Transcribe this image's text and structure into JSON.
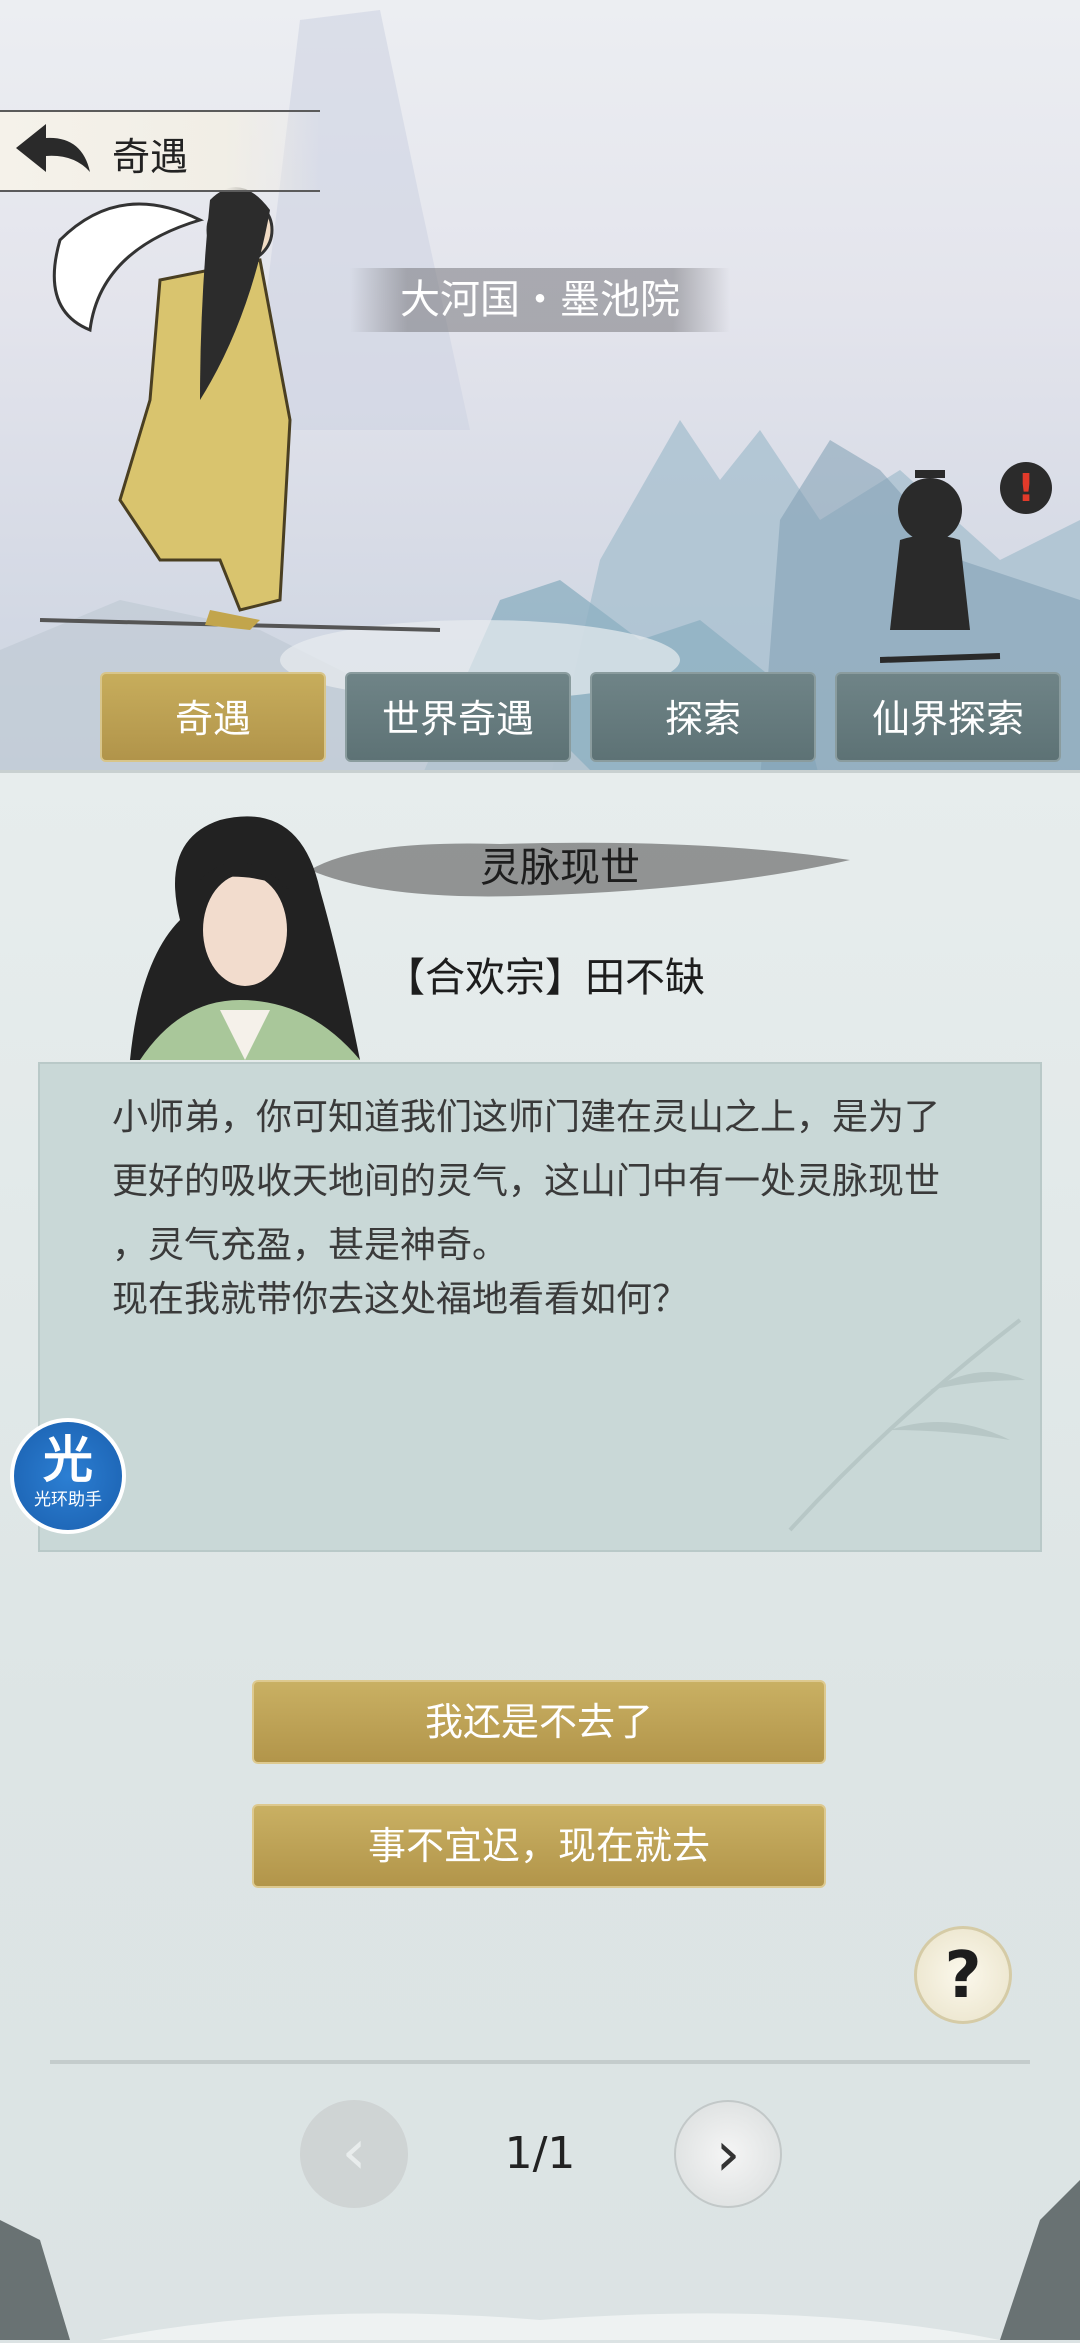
{
  "header": {
    "title": "奇遇"
  },
  "location": "大河国・墨池院",
  "npc": {
    "alert": "!"
  },
  "tabs": [
    {
      "label": "奇遇",
      "active": true
    },
    {
      "label": "世界奇遇",
      "active": false
    },
    {
      "label": "探索",
      "active": false
    },
    {
      "label": "仙界探索",
      "active": false
    }
  ],
  "event": {
    "title": "灵脉现世",
    "speaker": "【合欢宗】田不缺",
    "dialog": [
      "小师弟，你可知道我们这师门建在灵山之上，是为了",
      "更好的吸收天地间的灵气，这山门中有一处灵脉现世",
      "，灵气充盈，甚是神奇。",
      "现在我就带你去这处福地看看如何？"
    ]
  },
  "helper": {
    "big": "光",
    "small": "光环助手"
  },
  "choices": [
    "我还是不去了",
    "事不宜迟，现在就去"
  ],
  "help": {
    "label": "?"
  },
  "pagination": {
    "indicator": "1/1",
    "prev": "‹",
    "next": "›"
  },
  "colors": {
    "gold": "#c9b063",
    "tab": "#6f8487",
    "panel": "#dde5e5",
    "dialog": "#c9d8d7"
  },
  "icons": {
    "back": "back-arrow-icon",
    "help": "question-icon",
    "prev": "chevron-left-icon",
    "next": "chevron-right-icon"
  }
}
